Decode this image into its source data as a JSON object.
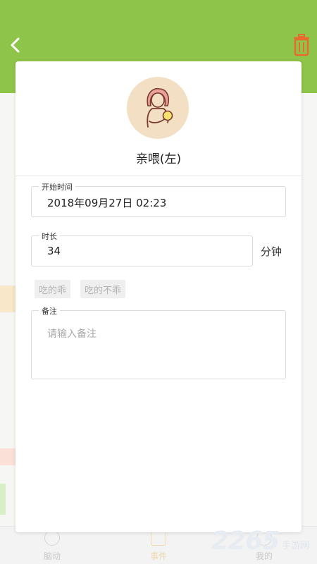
{
  "background": {
    "tabs": [
      {
        "label": "脑动",
        "active": false
      },
      {
        "label": "事件",
        "active": true
      },
      {
        "label": "我的",
        "active": false
      }
    ]
  },
  "header": {
    "back_icon": "chevron-left-icon",
    "delete_icon": "trash-icon"
  },
  "dialog": {
    "title": "亲喂(左)",
    "start_time": {
      "label": "开始时间",
      "value": "2018年09月27日 02:23"
    },
    "duration": {
      "label": "时长",
      "value": "34",
      "unit": "分钟"
    },
    "tags": [
      "吃的乖",
      "吃的不乖"
    ],
    "note": {
      "label": "备注",
      "placeholder": "请输入备注"
    }
  },
  "watermark": {
    "number": "2265",
    "text": "手游网"
  },
  "colors": {
    "header_green": "#8fc44a",
    "trash_orange": "#e96a2e",
    "avatar_bg": "#f2dfc4"
  }
}
